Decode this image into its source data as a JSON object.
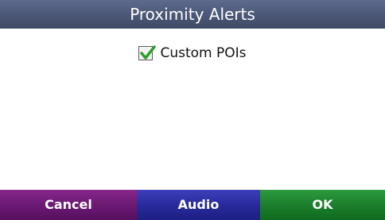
{
  "header": {
    "title": "Proximity Alerts"
  },
  "options": [
    {
      "label": "Custom POIs",
      "checked": true,
      "icon": "checkbox-checked-icon"
    }
  ],
  "buttons": {
    "cancel_label": "Cancel",
    "audio_label": "Audio",
    "ok_label": "OK"
  },
  "colors": {
    "title_bar": "#4c5878",
    "cancel": "#6b1a73",
    "audio": "#282a9c",
    "ok": "#1c7f2c",
    "checkmark": "#2f9e2f"
  }
}
